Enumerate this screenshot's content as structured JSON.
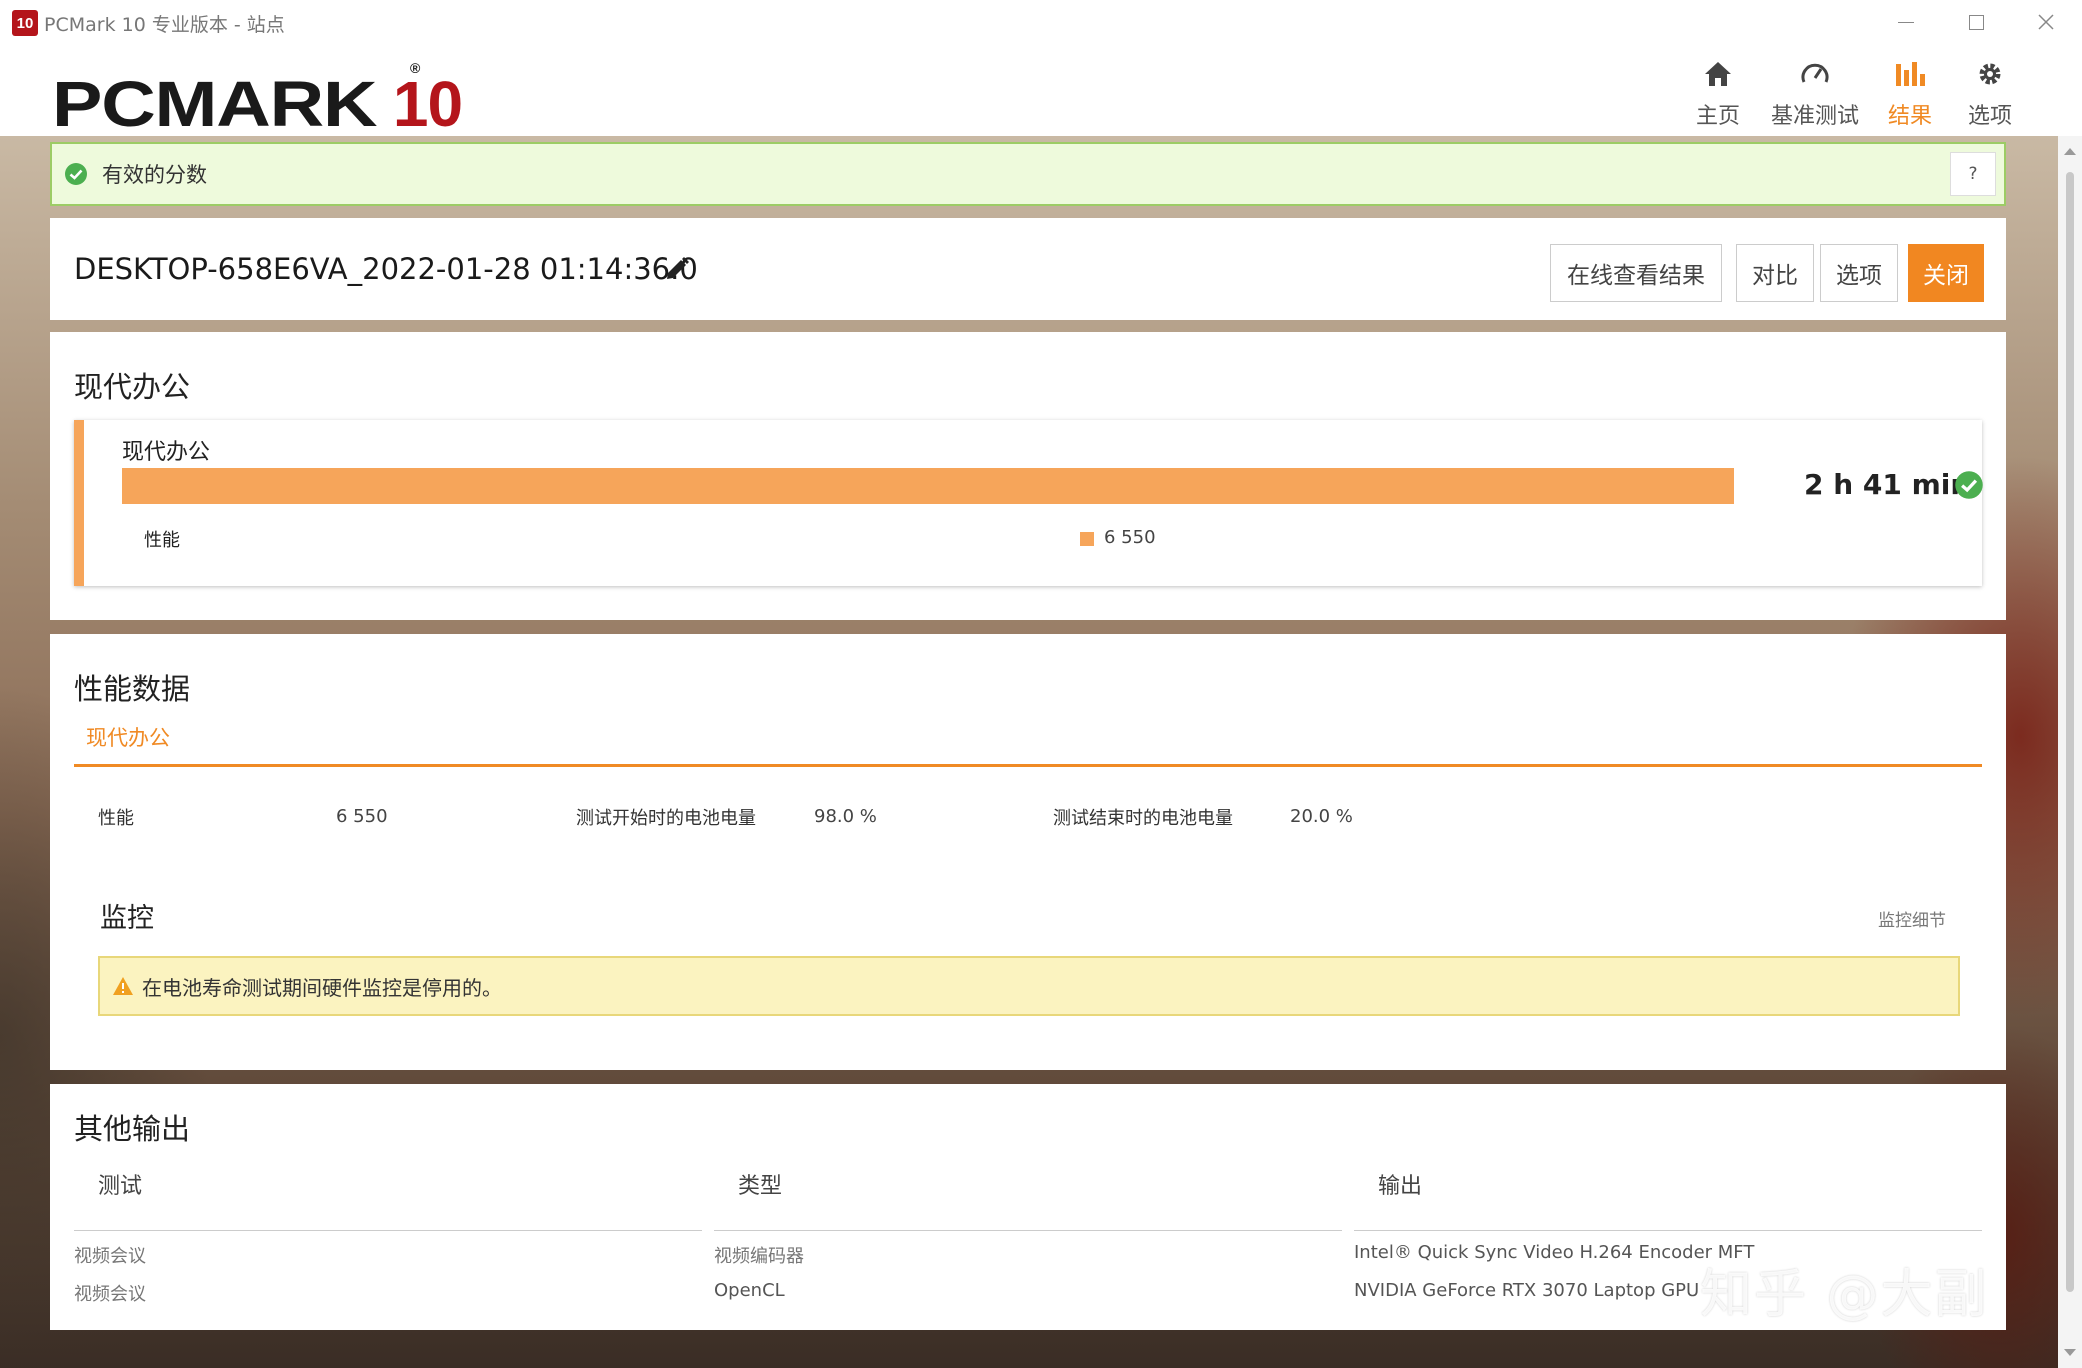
{
  "window": {
    "app_icon_text": "10",
    "title": "PCMark 10 专业版本 - 站点"
  },
  "header": {
    "logo_text": "PCMARK",
    "logo_number": "10",
    "logo_reg": "®",
    "nav": [
      {
        "label": "主页",
        "icon": "home-icon",
        "active": false
      },
      {
        "label": "基准测试",
        "icon": "gauge-icon",
        "active": false
      },
      {
        "label": "结果",
        "icon": "bar-chart-icon",
        "active": true
      },
      {
        "label": "选项",
        "icon": "gear-icon",
        "active": false
      }
    ]
  },
  "banner": {
    "text": "有效的分数",
    "help_label": "?"
  },
  "result": {
    "name": "DESKTOP-658E6VA_2022-01-28 01:14:36.0",
    "buttons": {
      "online": "在线查看结果",
      "compare": "对比",
      "options": "选项",
      "close": "关闭"
    }
  },
  "office": {
    "section_title": "现代办公",
    "card_title": "现代办公",
    "score": "2 h 41 min",
    "score_bar_fill": 1.0,
    "metric_label": "性能",
    "metric_value": "6 550",
    "colors": {
      "accent": "#f6a55a",
      "valid": "#4caf50"
    }
  },
  "performance": {
    "section_title": "性能数据",
    "active_tab": "现代办公",
    "rows": [
      {
        "label": "性能",
        "value": "6 550"
      },
      {
        "label": "测试开始时的电池电量",
        "value": "98.0 %"
      },
      {
        "label": "测试结束时的电池电量",
        "value": "20.0 %"
      }
    ],
    "monitoring": {
      "title": "监控",
      "details_link": "监控细节",
      "warning": "在电池寿命测试期间硬件监控是停用的。"
    }
  },
  "other_output": {
    "section_title": "其他输出",
    "columns": [
      "测试",
      "类型",
      "输出"
    ],
    "rows": [
      [
        "视频会议",
        "视频编码器",
        "Intel® Quick Sync Video H.264 Encoder MFT"
      ],
      [
        "视频会议",
        "OpenCL",
        "NVIDIA GeForce RTX 3070 Laptop GPU"
      ]
    ]
  },
  "watermark": "知乎 @大副"
}
